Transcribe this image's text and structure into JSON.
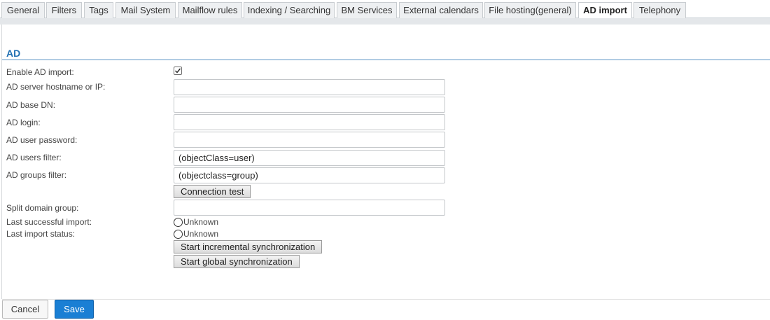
{
  "tabs": [
    {
      "label": "General",
      "active": false
    },
    {
      "label": "Filters",
      "active": false
    },
    {
      "label": "Tags",
      "active": false
    },
    {
      "label": "Mail System",
      "active": false
    },
    {
      "label": "Mailflow rules",
      "active": false
    },
    {
      "label": "Indexing / Searching",
      "active": false
    },
    {
      "label": "BM Services",
      "active": false
    },
    {
      "label": "External calendars",
      "active": false
    },
    {
      "label": "File hosting(general)",
      "active": false
    },
    {
      "label": "AD import",
      "active": true
    },
    {
      "label": "Telephony",
      "active": false
    }
  ],
  "section": {
    "title": "AD"
  },
  "form": {
    "enable_label": "Enable AD import:",
    "enable_checked": true,
    "hostname_label": "AD server hostname or IP:",
    "hostname_value": "",
    "base_dn_label": "AD base DN:",
    "base_dn_value": "",
    "login_label": "AD login:",
    "login_value": "",
    "password_label": "AD user password:",
    "password_value": "",
    "users_filter_label": "AD users filter:",
    "users_filter_value": "(objectClass=user)",
    "groups_filter_label": "AD groups filter:",
    "groups_filter_value": "(objectclass=group)",
    "connection_test_label": "Connection test",
    "split_domain_label": "Split domain group:",
    "split_domain_value": "",
    "last_import_label": "Last successful import:",
    "last_import_value": "Unknown",
    "last_status_label": "Last import status:",
    "last_status_value": "Unknown",
    "incremental_sync_label": "Start incremental synchronization",
    "global_sync_label": "Start global synchronization"
  },
  "footer": {
    "cancel_label": "Cancel",
    "save_label": "Save"
  },
  "colors": {
    "accent": "#1f6fb2",
    "save_button": "#1a7fd4"
  },
  "icons": {
    "checkbox": "check-icon",
    "status": "circle-icon"
  }
}
